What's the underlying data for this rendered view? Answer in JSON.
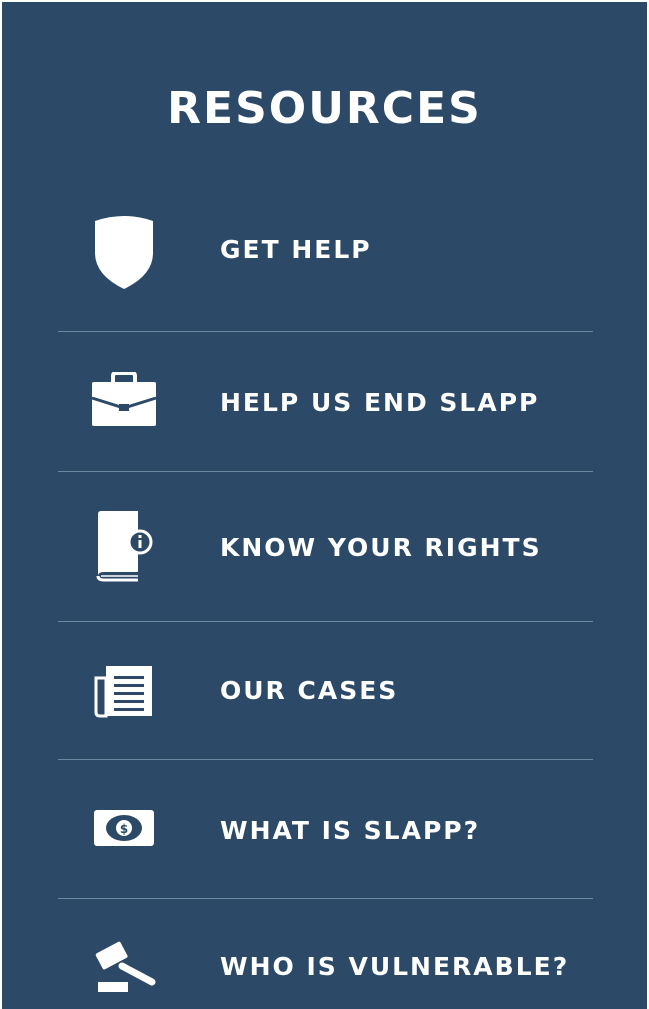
{
  "resources": {
    "title": "RESOURCES",
    "items": [
      {
        "label": "GET HELP",
        "icon": "shield-icon"
      },
      {
        "label": "HELP US END SLAPP",
        "icon": "briefcase-icon"
      },
      {
        "label": "KNOW YOUR RIGHTS",
        "icon": "book-info-icon"
      },
      {
        "label": "OUR CASES",
        "icon": "newspaper-icon"
      },
      {
        "label": "WHAT IS SLAPP?",
        "icon": "dollar-bill-icon"
      },
      {
        "label": "WHO IS VULNERABLE?",
        "icon": "gavel-icon"
      }
    ]
  },
  "colors": {
    "background": "#2c4a68",
    "text": "#ffffff",
    "divider": "#6f88a2"
  }
}
